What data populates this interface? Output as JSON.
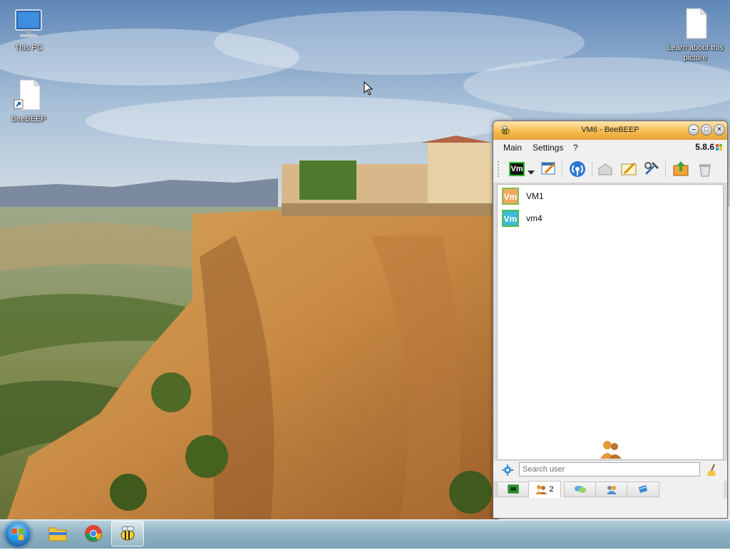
{
  "desktop": {
    "icons": [
      {
        "label": "This PC",
        "icon": "computer-icon"
      },
      {
        "label": "BeeBEEP",
        "icon": "shortcut-file-icon"
      },
      {
        "label": "Learn about this picture",
        "icon": "file-icon"
      }
    ]
  },
  "taskbar": {
    "items": [
      {
        "name": "start",
        "icon": "windows-orb-icon"
      },
      {
        "name": "file-explorer",
        "icon": "folder-icon"
      },
      {
        "name": "chrome",
        "icon": "chrome-icon"
      },
      {
        "name": "beebeep",
        "icon": "bee-icon",
        "active": true
      }
    ]
  },
  "window": {
    "title": "VM6 - BeeBEEP",
    "menu": {
      "main": "Main",
      "settings": "Settings",
      "help": "?"
    },
    "version": "5.8.6",
    "user_badge": "Vm",
    "users": [
      {
        "avatar": "Vm",
        "name": "VM1",
        "color": "#f4a762"
      },
      {
        "avatar": "Vm",
        "name": "vm4",
        "color": "#3fb8d8"
      }
    ],
    "search": {
      "placeholder": "Search user"
    },
    "tabs": [
      {
        "icon": "chat-screen-icon",
        "count": ""
      },
      {
        "icon": "users-icon",
        "count": "2"
      },
      {
        "icon": "chat-bubbles-icon",
        "count": ""
      },
      {
        "icon": "groups-icon",
        "count": ""
      },
      {
        "icon": "files-icon",
        "count": ""
      }
    ],
    "accent": "#f4b84a"
  }
}
